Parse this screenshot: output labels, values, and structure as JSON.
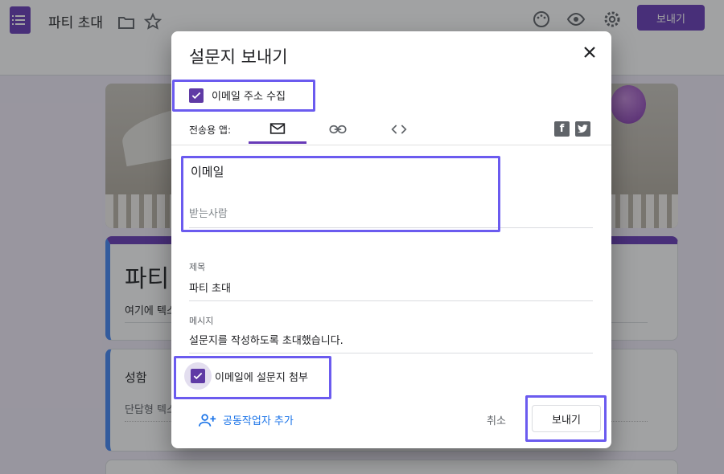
{
  "app": {
    "doc_title": "파티 초대",
    "send_button_label": "보내기"
  },
  "form": {
    "title": "파티",
    "description": "여기에 텍스",
    "question_title": "성함",
    "question_hint": "단답형 텍스"
  },
  "dialog": {
    "title": "설문지 보내기",
    "collect_email_label": "이메일 주소 수집",
    "collect_email_checked": true,
    "send_via_label": "전송용 앱:",
    "send_via_tabs": [
      {
        "icon": "mail-icon",
        "active": true
      },
      {
        "icon": "link-icon",
        "active": false
      },
      {
        "icon": "embed-icon",
        "active": false
      }
    ],
    "share_icons": [
      "facebook-icon",
      "twitter-icon"
    ],
    "email_label": "이메일",
    "recipients_placeholder": "받는사람",
    "subject_label": "제목",
    "subject_value": "파티 초대",
    "message_label": "메시지",
    "message_value": "설문지를 작성하도록 초대했습니다.",
    "attach_label": "이메일에 설문지 첨부",
    "attach_checked": true,
    "add_collaborators_label": "공동작업자 추가",
    "cancel_label": "취소",
    "send_label": "보내기"
  },
  "colors": {
    "brand": "#673ab7",
    "checkbox": "#5f3aa5",
    "link": "#1a73e8",
    "highlight": "#6b5bef"
  }
}
